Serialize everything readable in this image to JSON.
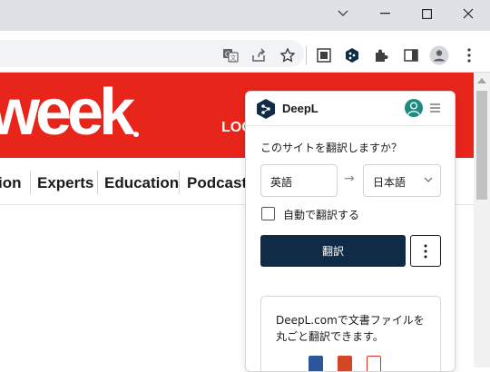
{
  "browser": {
    "window_controls": {
      "tab_search": "chevron-down-icon",
      "minimize": "minimize-icon",
      "maximize": "maximize-icon",
      "close": "close-icon"
    },
    "toolbar_icons": [
      "translate-page-icon",
      "share-icon",
      "bookmark-star-icon",
      "screenshot-icon",
      "deepl-extension-icon",
      "extensions-puzzle-icon",
      "side-panel-icon",
      "profile-icon",
      "kebab-menu-icon"
    ]
  },
  "site": {
    "logo_text": "week",
    "login_text": "LOG",
    "nav_items": [
      "ion",
      "Experts",
      "Education",
      "Podcasts"
    ],
    "brand_color": "#e8251b"
  },
  "deepl": {
    "brand_name": "DeepL",
    "question": "このサイトを翻訳しますか？",
    "source_lang": "英語",
    "arrow": "→",
    "target_lang": "日本語",
    "auto_translate_label": "自動で翻訳する",
    "auto_translate_checked": false,
    "translate_button": "翻訳",
    "promo_line1": "DeepL.comで文書ファイルを",
    "promo_line2": "丸ごと翻訳できます。",
    "accent_color": "#0f2b46",
    "avatar_color": "#1f8a80"
  }
}
